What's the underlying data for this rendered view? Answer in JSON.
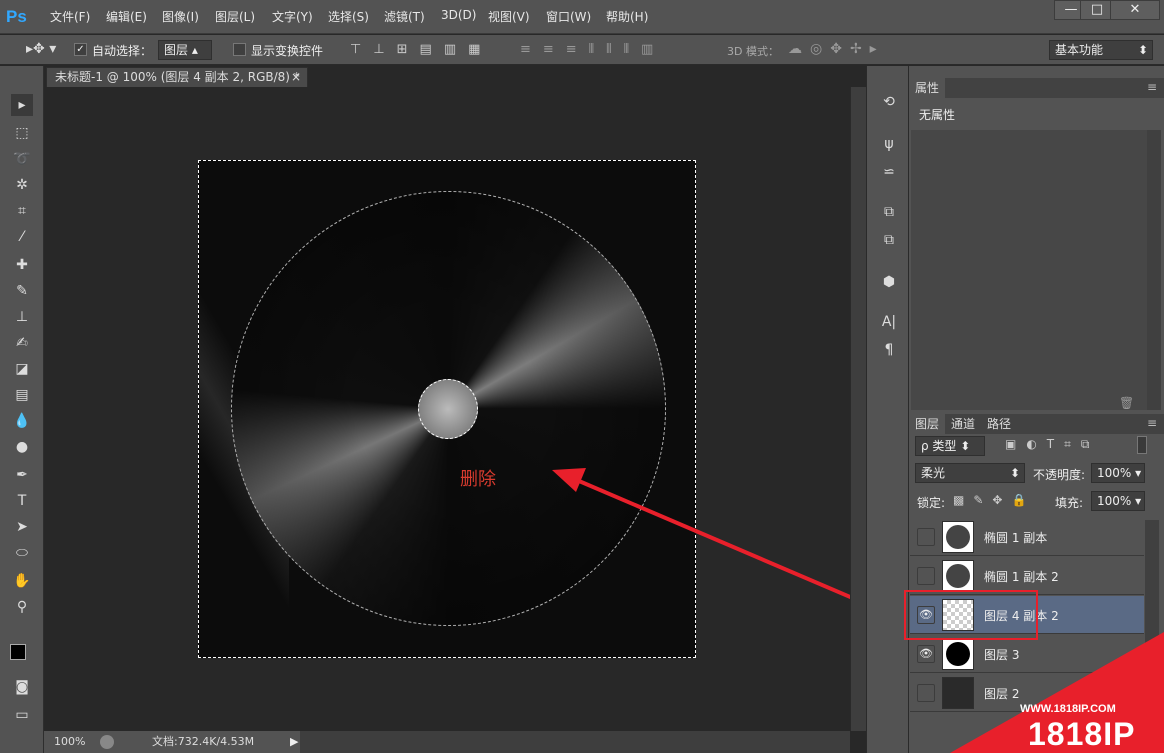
{
  "app": {
    "logo": "Ps",
    "menu": [
      "文件(F)",
      "编辑(E)",
      "图像(I)",
      "图层(L)",
      "文字(Y)",
      "选择(S)",
      "滤镜(T)",
      "3D(D)",
      "视图(V)",
      "窗口(W)",
      "帮助(H)"
    ]
  },
  "options": {
    "auto_select_label": "自动选择：",
    "auto_select_value": "图层",
    "show_transform_label": "显示变换控件",
    "mode3d_label": "3D 模式：",
    "workspace": "基本功能"
  },
  "document": {
    "tab_title": "未标题-1 @ 100% (图层 4 副本 2, RGB/8) *",
    "close": "×"
  },
  "canvas": {
    "annotation": "删除"
  },
  "status": {
    "zoom": "100%",
    "doc_size": "文档:732.4K/4.53M"
  },
  "properties": {
    "tab": "属性",
    "content": "无属性"
  },
  "layers_panel": {
    "tabs": [
      "图层",
      "通道",
      "路径"
    ],
    "filter_label": "ρ 类型",
    "blend_mode": "柔光",
    "opacity_label": "不透明度:",
    "opacity_value": "100%",
    "lock_label": "锁定:",
    "fill_label": "填充:",
    "fill_value": "100%",
    "layers": [
      {
        "name": "椭圆 1 副本",
        "visible": false,
        "selected": false
      },
      {
        "name": "椭圆 1 副本 2",
        "visible": false,
        "selected": false
      },
      {
        "name": "图层 4 副本 2",
        "visible": true,
        "selected": true
      },
      {
        "name": "图层 3",
        "visible": true,
        "selected": false
      },
      {
        "name": "图层 2",
        "visible": false,
        "selected": false
      }
    ]
  },
  "watermark": {
    "url": "WWW.1818IP.COM",
    "brand": "1818IP"
  },
  "colors": {
    "highlight": "#e8202b",
    "selected_layer": "#5a6a85",
    "ps_blue": "#31a8ff"
  }
}
